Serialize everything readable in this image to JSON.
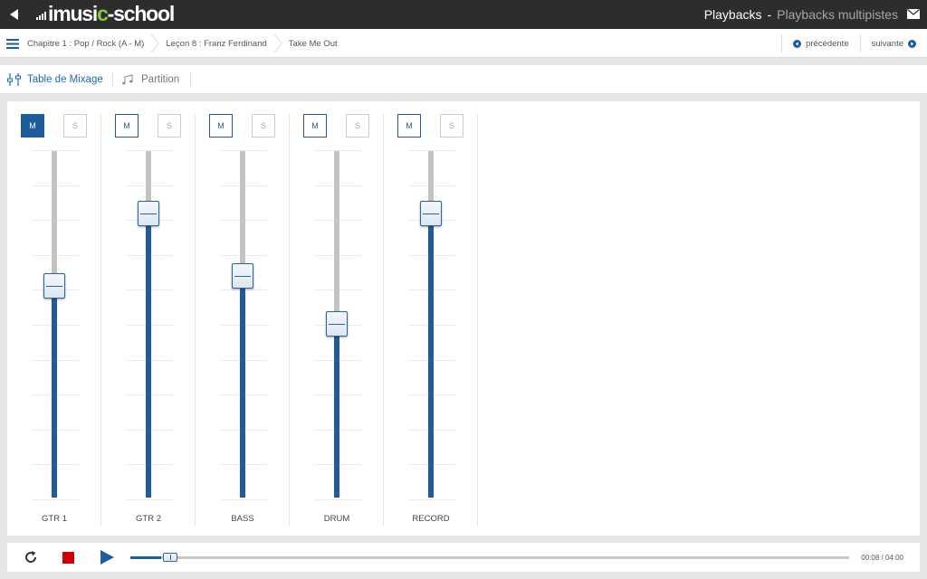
{
  "topbar": {
    "logo": {
      "prefix": "imusi",
      "accent": "c",
      "suffix": "-school"
    },
    "title_main": "Playbacks",
    "title_sep": "-",
    "title_sub": "Playbacks multipistes"
  },
  "breadcrumb": {
    "items": [
      "Chapitre 1 : Pop / Rock (A - M)",
      "Leçon 8 : Franz Ferdinand",
      "Take Me Out"
    ],
    "prev_label": "précédente",
    "next_label": "suivante"
  },
  "tabs": [
    {
      "label": "Table de Mixage",
      "active": true
    },
    {
      "label": "Partition",
      "active": false
    }
  ],
  "mixer": {
    "mute_label": "M",
    "solo_label": "S",
    "channels": [
      {
        "name": "GTR 1",
        "volume": 0.61,
        "mute_active": true
      },
      {
        "name": "GTR 2",
        "volume": 0.82,
        "mute_active": false
      },
      {
        "name": "BASS",
        "volume": 0.64,
        "mute_active": false
      },
      {
        "name": "DRUM",
        "volume": 0.5,
        "mute_active": false
      },
      {
        "name": "RECORD",
        "volume": 0.82,
        "mute_active": false
      }
    ]
  },
  "transport": {
    "time": "00:08 / 04:00",
    "progress": 0.033
  },
  "colors": {
    "accent": "#1f5c9e",
    "logo_accent": "#8dc63f",
    "stop": "#cc0000",
    "topbar": "#2d2d2d"
  },
  "icons": [
    "back-arrow-icon",
    "mail-icon",
    "menu-icon",
    "mixer-icon",
    "music-notes-icon",
    "reload-icon",
    "stop-icon",
    "play-icon"
  ]
}
